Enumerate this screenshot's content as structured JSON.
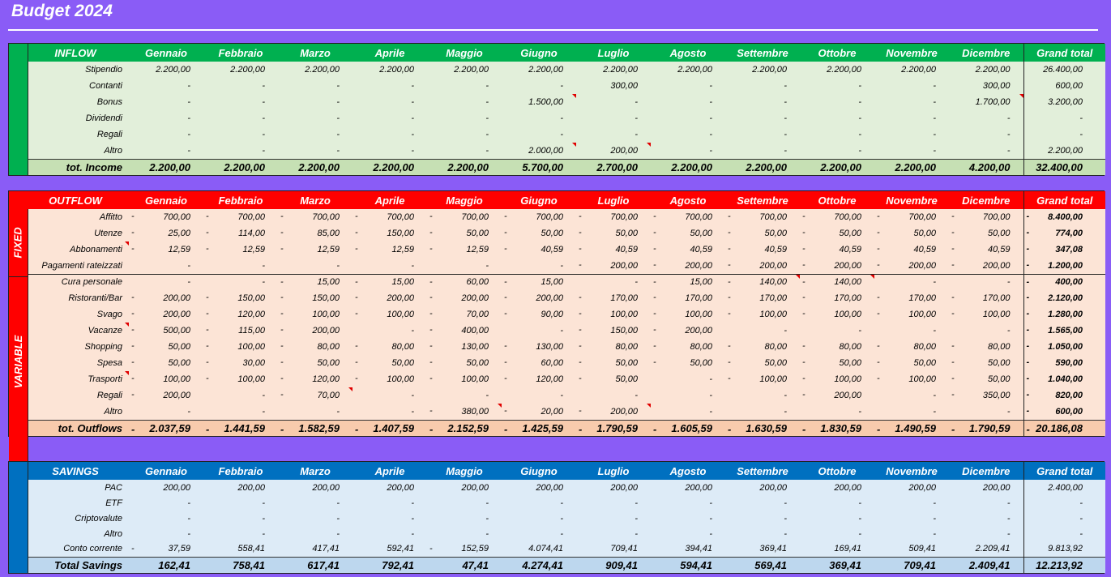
{
  "title": "Budget 2024",
  "months": [
    "Gennaio",
    "Febbraio",
    "Marzo",
    "Aprile",
    "Maggio",
    "Giugno",
    "Luglio",
    "Agosto",
    "Settembre",
    "Ottobre",
    "Novembre",
    "Dicembre"
  ],
  "grand_total_label": "Grand total",
  "colors": {
    "inflow_header": "#00b050",
    "inflow_body": "#e2efda",
    "outflow_header": "#ff0000",
    "outflow_body": "#fce4d6",
    "outflow_total": "#f8cbad",
    "savings_header": "#0070c0",
    "savings_body": "#ddebf7",
    "inflow_total": "#c6e0b4",
    "savings_total": "#bdd7ee"
  },
  "inflow": {
    "label": "INFLOW",
    "rows": [
      {
        "label": "Stipendio",
        "values": [
          "2.200,00",
          "2.200,00",
          "2.200,00",
          "2.200,00",
          "2.200,00",
          "2.200,00",
          "2.200,00",
          "2.200,00",
          "2.200,00",
          "2.200,00",
          "2.200,00",
          "2.200,00"
        ],
        "total": "26.400,00",
        "flags": []
      },
      {
        "label": "Contanti",
        "values": [
          "-",
          "-",
          "-",
          "-",
          "-",
          "-",
          "300,00",
          "-",
          "-",
          "-",
          "-",
          "300,00"
        ],
        "total": "600,00",
        "flags": []
      },
      {
        "label": "Bonus",
        "values": [
          "-",
          "-",
          "-",
          "-",
          "-",
          "1.500,00",
          "-",
          "-",
          "-",
          "-",
          "-",
          "1.700,00"
        ],
        "total": "3.200,00",
        "flags": [
          5,
          11
        ]
      },
      {
        "label": "Dividendi",
        "values": [
          "-",
          "-",
          "-",
          "-",
          "-",
          "-",
          "-",
          "-",
          "-",
          "-",
          "-",
          "-"
        ],
        "total": "-",
        "flags": []
      },
      {
        "label": "Regali",
        "values": [
          "-",
          "-",
          "-",
          "-",
          "-",
          "-",
          "-",
          "-",
          "-",
          "-",
          "-",
          "-"
        ],
        "total": "-",
        "flags": []
      },
      {
        "label": "Altro",
        "values": [
          "-",
          "-",
          "-",
          "-",
          "-",
          "2.000,00",
          "200,00",
          "-",
          "-",
          "-",
          "-",
          "-"
        ],
        "total": "2.200,00",
        "flags": [
          5,
          6
        ]
      }
    ],
    "total": {
      "label": "tot. Income",
      "values": [
        "2.200,00",
        "2.200,00",
        "2.200,00",
        "2.200,00",
        "2.200,00",
        "5.700,00",
        "2.700,00",
        "2.200,00",
        "2.200,00",
        "2.200,00",
        "2.200,00",
        "4.200,00"
      ],
      "total": "32.400,00"
    }
  },
  "outflow": {
    "label": "OUTFLOW",
    "fixed_label": "FIXED",
    "variable_label": "VARIABLE",
    "fixed_rows": [
      {
        "label": "Affitto",
        "values": [
          "700,00",
          "700,00",
          "700,00",
          "700,00",
          "700,00",
          "700,00",
          "700,00",
          "700,00",
          "700,00",
          "700,00",
          "700,00",
          "700,00"
        ],
        "neg": [
          1,
          1,
          1,
          1,
          1,
          1,
          1,
          1,
          1,
          1,
          1,
          1
        ],
        "total": "8.400,00",
        "tneg": 1,
        "flags": []
      },
      {
        "label": "Utenze",
        "values": [
          "25,00",
          "114,00",
          "85,00",
          "150,00",
          "50,00",
          "50,00",
          "50,00",
          "50,00",
          "50,00",
          "50,00",
          "50,00",
          "50,00"
        ],
        "neg": [
          1,
          1,
          1,
          1,
          1,
          1,
          1,
          1,
          1,
          1,
          1,
          1
        ],
        "total": "774,00",
        "tneg": 1,
        "flags": []
      },
      {
        "label": "Abbonamenti",
        "values": [
          "12,59",
          "12,59",
          "12,59",
          "12,59",
          "12,59",
          "40,59",
          "40,59",
          "40,59",
          "40,59",
          "40,59",
          "40,59",
          "40,59"
        ],
        "neg": [
          1,
          1,
          1,
          1,
          1,
          1,
          1,
          1,
          1,
          1,
          1,
          1
        ],
        "total": "347,08",
        "tneg": 1,
        "flags": [
          -1
        ]
      },
      {
        "label": "Pagamenti rateizzati",
        "values": [
          "-",
          "-",
          "-",
          "-",
          "-",
          "-",
          "200,00",
          "200,00",
          "200,00",
          "200,00",
          "200,00",
          "200,00"
        ],
        "neg": [
          0,
          0,
          0,
          0,
          0,
          0,
          1,
          1,
          1,
          1,
          1,
          1
        ],
        "total": "1.200,00",
        "tneg": 1,
        "flags": []
      }
    ],
    "variable_rows": [
      {
        "label": "Cura personale",
        "values": [
          "-",
          "-",
          "15,00",
          "15,00",
          "60,00",
          "15,00",
          "-",
          "15,00",
          "140,00",
          "140,00",
          "-",
          "-"
        ],
        "neg": [
          0,
          0,
          1,
          1,
          1,
          1,
          0,
          1,
          1,
          1,
          0,
          0
        ],
        "total": "400,00",
        "tneg": 1,
        "flags": [
          8,
          9
        ]
      },
      {
        "label": "Ristoranti/Bar",
        "values": [
          "200,00",
          "150,00",
          "150,00",
          "200,00",
          "200,00",
          "200,00",
          "170,00",
          "170,00",
          "170,00",
          "170,00",
          "170,00",
          "170,00"
        ],
        "neg": [
          1,
          1,
          1,
          1,
          1,
          1,
          1,
          1,
          1,
          1,
          1,
          1
        ],
        "total": "2.120,00",
        "tneg": 1,
        "flags": []
      },
      {
        "label": "Svago",
        "values": [
          "200,00",
          "120,00",
          "100,00",
          "100,00",
          "70,00",
          "90,00",
          "100,00",
          "100,00",
          "100,00",
          "100,00",
          "100,00",
          "100,00"
        ],
        "neg": [
          1,
          1,
          1,
          1,
          1,
          1,
          1,
          1,
          1,
          1,
          1,
          1
        ],
        "total": "1.280,00",
        "tneg": 1,
        "flags": []
      },
      {
        "label": "Vacanze",
        "values": [
          "500,00",
          "115,00",
          "200,00",
          "-",
          "400,00",
          "-",
          "150,00",
          "200,00",
          "-",
          "-",
          "-",
          "-"
        ],
        "neg": [
          1,
          1,
          1,
          0,
          1,
          0,
          1,
          1,
          0,
          0,
          0,
          0
        ],
        "total": "1.565,00",
        "tneg": 1,
        "flags": [
          -1
        ]
      },
      {
        "label": "Shopping",
        "values": [
          "50,00",
          "100,00",
          "80,00",
          "80,00",
          "130,00",
          "130,00",
          "80,00",
          "80,00",
          "80,00",
          "80,00",
          "80,00",
          "80,00"
        ],
        "neg": [
          1,
          1,
          1,
          1,
          1,
          1,
          1,
          1,
          1,
          1,
          1,
          1
        ],
        "total": "1.050,00",
        "tneg": 1,
        "flags": []
      },
      {
        "label": "Spesa",
        "values": [
          "50,00",
          "30,00",
          "50,00",
          "50,00",
          "50,00",
          "60,00",
          "50,00",
          "50,00",
          "50,00",
          "50,00",
          "50,00",
          "50,00"
        ],
        "neg": [
          1,
          1,
          1,
          1,
          1,
          1,
          1,
          1,
          1,
          1,
          1,
          1
        ],
        "total": "590,00",
        "tneg": 1,
        "flags": []
      },
      {
        "label": "Trasporti",
        "values": [
          "100,00",
          "100,00",
          "120,00",
          "100,00",
          "100,00",
          "120,00",
          "50,00",
          "-",
          "100,00",
          "100,00",
          "100,00",
          "50,00"
        ],
        "neg": [
          1,
          1,
          1,
          1,
          1,
          1,
          1,
          0,
          1,
          1,
          1,
          1
        ],
        "total": "1.040,00",
        "tneg": 1,
        "flags": [
          -1
        ]
      },
      {
        "label": "Regali",
        "values": [
          "200,00",
          "-",
          "70,00",
          "-",
          "-",
          "-",
          "-",
          "-",
          "-",
          "200,00",
          "-",
          "350,00"
        ],
        "neg": [
          1,
          0,
          1,
          0,
          0,
          0,
          0,
          0,
          0,
          1,
          0,
          1
        ],
        "total": "820,00",
        "tneg": 1,
        "flags": [
          2
        ]
      },
      {
        "label": "Altro",
        "values": [
          "-",
          "-",
          "-",
          "-",
          "380,00",
          "20,00",
          "200,00",
          "-",
          "-",
          "-",
          "-",
          "-"
        ],
        "neg": [
          0,
          0,
          0,
          0,
          1,
          1,
          1,
          0,
          0,
          0,
          0,
          0
        ],
        "total": "600,00",
        "tneg": 1,
        "flags": [
          4,
          6
        ]
      }
    ],
    "total": {
      "label": "tot. Outflows",
      "values": [
        "2.037,59",
        "1.441,59",
        "1.582,59",
        "1.407,59",
        "2.152,59",
        "1.425,59",
        "1.790,59",
        "1.605,59",
        "1.630,59",
        "1.830,59",
        "1.490,59",
        "1.790,59"
      ],
      "total": "20.186,08"
    }
  },
  "savings": {
    "label": "SAVINGS",
    "rows": [
      {
        "label": "PAC",
        "values": [
          "200,00",
          "200,00",
          "200,00",
          "200,00",
          "200,00",
          "200,00",
          "200,00",
          "200,00",
          "200,00",
          "200,00",
          "200,00",
          "200,00"
        ],
        "neg": [
          0,
          0,
          0,
          0,
          0,
          0,
          0,
          0,
          0,
          0,
          0,
          0
        ],
        "total": "2.400,00"
      },
      {
        "label": "ETF",
        "values": [
          "-",
          "-",
          "-",
          "-",
          "-",
          "-",
          "-",
          "-",
          "-",
          "-",
          "-",
          "-"
        ],
        "neg": [
          0,
          0,
          0,
          0,
          0,
          0,
          0,
          0,
          0,
          0,
          0,
          0
        ],
        "total": "-"
      },
      {
        "label": "Criptovalute",
        "values": [
          "-",
          "-",
          "-",
          "-",
          "-",
          "-",
          "-",
          "-",
          "-",
          "-",
          "-",
          "-"
        ],
        "neg": [
          0,
          0,
          0,
          0,
          0,
          0,
          0,
          0,
          0,
          0,
          0,
          0
        ],
        "total": "-"
      },
      {
        "label": "Altro",
        "values": [
          "-",
          "-",
          "-",
          "-",
          "-",
          "-",
          "-",
          "-",
          "-",
          "-",
          "-",
          "-"
        ],
        "neg": [
          0,
          0,
          0,
          0,
          0,
          0,
          0,
          0,
          0,
          0,
          0,
          0
        ],
        "total": "-"
      },
      {
        "label": "Conto corrente",
        "values": [
          "37,59",
          "558,41",
          "417,41",
          "592,41",
          "152,59",
          "4.074,41",
          "709,41",
          "394,41",
          "369,41",
          "169,41",
          "509,41",
          "2.209,41"
        ],
        "neg": [
          1,
          0,
          0,
          0,
          1,
          0,
          0,
          0,
          0,
          0,
          0,
          0
        ],
        "total": "9.813,92"
      }
    ],
    "total": {
      "label": "Total Savings",
      "values": [
        "162,41",
        "758,41",
        "617,41",
        "792,41",
        "47,41",
        "4.274,41",
        "909,41",
        "594,41",
        "569,41",
        "369,41",
        "709,41",
        "2.409,41"
      ],
      "total": "12.213,92"
    }
  }
}
